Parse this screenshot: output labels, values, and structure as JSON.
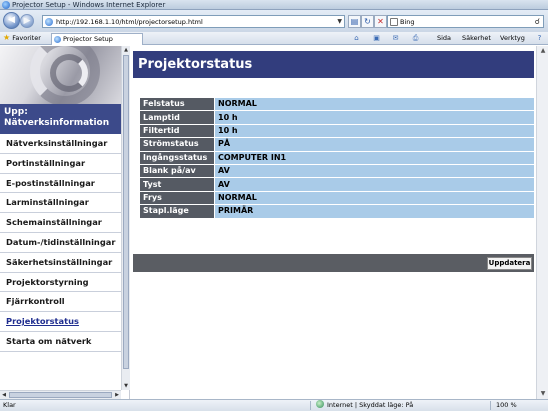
{
  "window": {
    "title": "Projector Setup - Windows Internet Explorer"
  },
  "address": {
    "url": "http://192.168.1.10/html/projectorsetup.html",
    "search_text": "Bing"
  },
  "commandbar": {
    "favorites_label": "Favoriter",
    "tab_label": "Projector Setup",
    "page_menu": "Sida",
    "safety_menu": "Säkerhet",
    "tools_menu": "Verktyg"
  },
  "sidebar": {
    "heading": "Upp:\nNätverksinformation",
    "items": [
      {
        "label": "Nätverksinställningar"
      },
      {
        "label": "Portinställningar"
      },
      {
        "label": "E-postinställningar"
      },
      {
        "label": "Larminställningar"
      },
      {
        "label": "Schemainställningar"
      },
      {
        "label": "Datum-/tidinställningar"
      },
      {
        "label": "Säkerhetsinställningar"
      },
      {
        "label": "Projektorstyrning"
      },
      {
        "label": "Fjärrkontroll"
      },
      {
        "label": "Projektorstatus"
      },
      {
        "label": "Starta om nätverk"
      }
    ]
  },
  "main": {
    "title": "Projektorstatus",
    "rows": [
      {
        "key": "Felstatus",
        "value": "NORMAL"
      },
      {
        "key": "Lamptid",
        "value": "10 h"
      },
      {
        "key": "Filtertid",
        "value": "10 h"
      },
      {
        "key": "Strömstatus",
        "value": "PÅ"
      },
      {
        "key": "Ingångsstatus",
        "value": "COMPUTER IN1"
      },
      {
        "key": "Blank på/av",
        "value": "AV"
      },
      {
        "key": "Tyst",
        "value": "AV"
      },
      {
        "key": "Frys",
        "value": "NORMAL"
      },
      {
        "key": "Stapl.läge",
        "value": "PRIMÄR"
      }
    ],
    "update_button": "Uppdatera"
  },
  "statusbar": {
    "status": "Klar",
    "zone": "Internet | Skyddat läge: På",
    "zoom": "100 %"
  },
  "colors": {
    "title_band": "#323d7d",
    "sidebar_heading": "#3c4a8a",
    "key_cell": "#555a63",
    "value_cell": "#a9cbe8",
    "update_bar": "#5a5d63"
  }
}
